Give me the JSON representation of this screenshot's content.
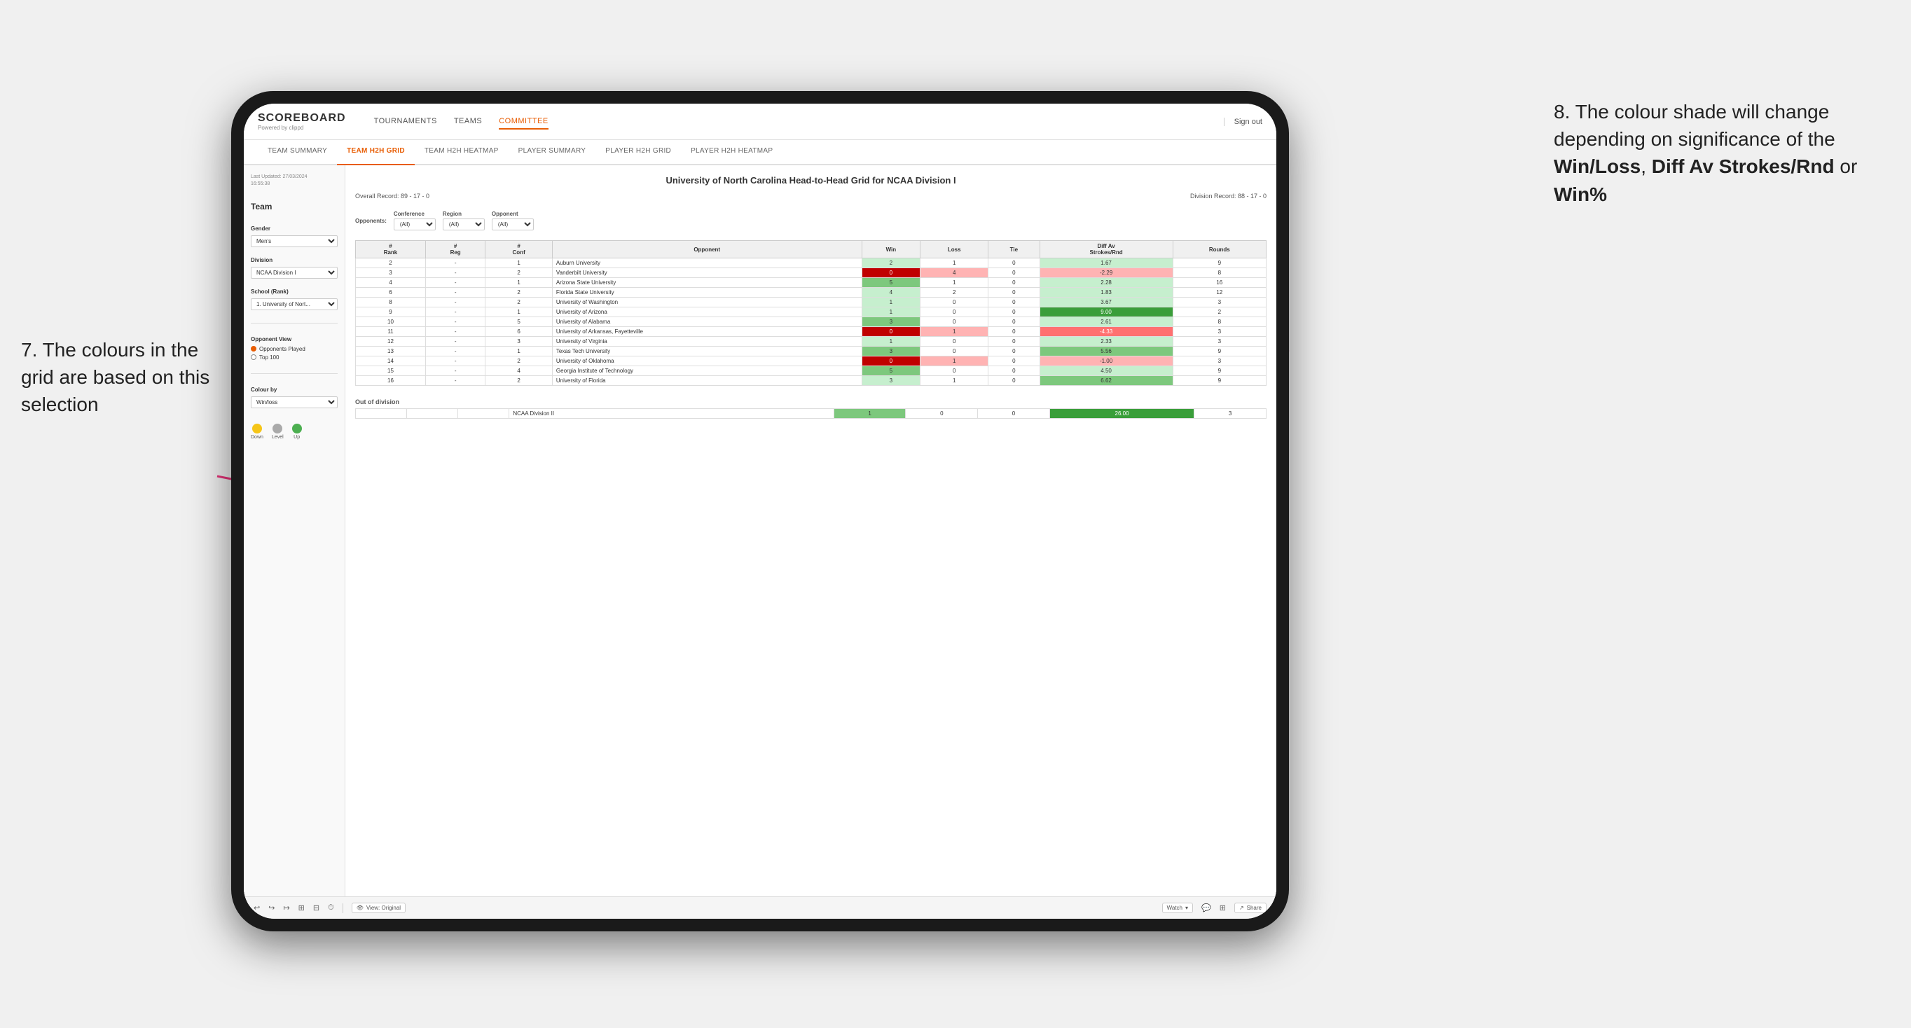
{
  "annotations": {
    "left": "7. The colours in the grid are based on this selection",
    "right_prefix": "8. The colour shade will change depending on significance of the ",
    "right_bold1": "Win/Loss",
    "right_sep1": ", ",
    "right_bold2": "Diff Av Strokes/Rnd",
    "right_sep2": " or ",
    "right_bold3": "Win%"
  },
  "nav": {
    "logo": "SCOREBOARD",
    "logo_sub": "Powered by clippd",
    "links": [
      "TOURNAMENTS",
      "TEAMS",
      "COMMITTEE"
    ],
    "active_link": "COMMITTEE",
    "sign_out": "Sign out"
  },
  "sub_nav": {
    "items": [
      "TEAM SUMMARY",
      "TEAM H2H GRID",
      "TEAM H2H HEATMAP",
      "PLAYER SUMMARY",
      "PLAYER H2H GRID",
      "PLAYER H2H HEATMAP"
    ],
    "active": "TEAM H2H GRID"
  },
  "sidebar": {
    "last_updated_label": "Last Updated: 27/03/2024",
    "last_updated_time": "16:55:38",
    "team_label": "Team",
    "team_value": "",
    "gender_label": "Gender",
    "gender_value": "Men's",
    "division_label": "Division",
    "division_value": "NCAA Division I",
    "school_label": "School (Rank)",
    "school_value": "1. University of Nort...",
    "opponent_view_label": "Opponent View",
    "radio_options": [
      "Opponents Played",
      "Top 100"
    ],
    "radio_selected": "Opponents Played",
    "colour_by_label": "Colour by",
    "colour_by_value": "Win/loss",
    "legend": {
      "down_label": "Down",
      "level_label": "Level",
      "up_label": "Up",
      "down_color": "#f5c518",
      "level_color": "#aaaaaa",
      "up_color": "#4caf50"
    }
  },
  "grid": {
    "title": "University of North Carolina Head-to-Head Grid for NCAA Division I",
    "overall_record": "Overall Record: 89 - 17 - 0",
    "division_record": "Division Record: 88 - 17 - 0",
    "filters": {
      "conference_label": "Conference",
      "conference_value": "(All)",
      "region_label": "Region",
      "region_value": "(All)",
      "opponent_label": "Opponent",
      "opponent_value": "(All)",
      "opponents_label": "Opponents:"
    },
    "table_headers": [
      "#\nRank",
      "#\nReg",
      "#\nConf",
      "Opponent",
      "Win",
      "Loss",
      "Tie",
      "Diff Av\nStrokes/Rnd",
      "Rounds"
    ],
    "rows": [
      {
        "rank": "2",
        "reg": "-",
        "conf": "1",
        "opponent": "Auburn University",
        "win": 2,
        "loss": 1,
        "tie": 0,
        "diff": "1.67",
        "rounds": 9,
        "win_color": "green-light",
        "loss_color": "neutral",
        "diff_color": "green-light"
      },
      {
        "rank": "3",
        "reg": "-",
        "conf": "2",
        "opponent": "Vanderbilt University",
        "win": 0,
        "loss": 4,
        "tie": 0,
        "diff": "-2.29",
        "rounds": 8,
        "win_color": "red-dark",
        "loss_color": "red-light",
        "diff_color": "red-light"
      },
      {
        "rank": "4",
        "reg": "-",
        "conf": "1",
        "opponent": "Arizona State University",
        "win": 5,
        "loss": 1,
        "tie": 0,
        "diff": "2.28",
        "rounds": 16,
        "win_color": "green-mid",
        "loss_color": "neutral",
        "diff_color": "green-light"
      },
      {
        "rank": "6",
        "reg": "-",
        "conf": "2",
        "opponent": "Florida State University",
        "win": 4,
        "loss": 2,
        "tie": 0,
        "diff": "1.83",
        "rounds": 12,
        "win_color": "green-light",
        "loss_color": "neutral",
        "diff_color": "green-light"
      },
      {
        "rank": "8",
        "reg": "-",
        "conf": "2",
        "opponent": "University of Washington",
        "win": 1,
        "loss": 0,
        "tie": 0,
        "diff": "3.67",
        "rounds": 3,
        "win_color": "green-light",
        "loss_color": "neutral",
        "diff_color": "green-light"
      },
      {
        "rank": "9",
        "reg": "-",
        "conf": "1",
        "opponent": "University of Arizona",
        "win": 1,
        "loss": 0,
        "tie": 0,
        "diff": "9.00",
        "rounds": 2,
        "win_color": "green-light",
        "loss_color": "neutral",
        "diff_color": "green-dark"
      },
      {
        "rank": "10",
        "reg": "-",
        "conf": "5",
        "opponent": "University of Alabama",
        "win": 3,
        "loss": 0,
        "tie": 0,
        "diff": "2.61",
        "rounds": 8,
        "win_color": "green-mid",
        "loss_color": "neutral",
        "diff_color": "green-light"
      },
      {
        "rank": "11",
        "reg": "-",
        "conf": "6",
        "opponent": "University of Arkansas, Fayetteville",
        "win": 0,
        "loss": 1,
        "tie": 0,
        "diff": "-4.33",
        "rounds": 3,
        "win_color": "red-dark",
        "loss_color": "red-light",
        "diff_color": "red-mid"
      },
      {
        "rank": "12",
        "reg": "-",
        "conf": "3",
        "opponent": "University of Virginia",
        "win": 1,
        "loss": 0,
        "tie": 0,
        "diff": "2.33",
        "rounds": 3,
        "win_color": "green-light",
        "loss_color": "neutral",
        "diff_color": "green-light"
      },
      {
        "rank": "13",
        "reg": "-",
        "conf": "1",
        "opponent": "Texas Tech University",
        "win": 3,
        "loss": 0,
        "tie": 0,
        "diff": "5.56",
        "rounds": 9,
        "win_color": "green-mid",
        "loss_color": "neutral",
        "diff_color": "green-mid"
      },
      {
        "rank": "14",
        "reg": "-",
        "conf": "2",
        "opponent": "University of Oklahoma",
        "win": 0,
        "loss": 1,
        "tie": 0,
        "diff": "-1.00",
        "rounds": 3,
        "win_color": "red-dark",
        "loss_color": "red-light",
        "diff_color": "red-light"
      },
      {
        "rank": "15",
        "reg": "-",
        "conf": "4",
        "opponent": "Georgia Institute of Technology",
        "win": 5,
        "loss": 0,
        "tie": 0,
        "diff": "4.50",
        "rounds": 9,
        "win_color": "green-mid",
        "loss_color": "neutral",
        "diff_color": "green-light"
      },
      {
        "rank": "16",
        "reg": "-",
        "conf": "2",
        "opponent": "University of Florida",
        "win": 3,
        "loss": 1,
        "tie": 0,
        "diff": "6.62",
        "rounds": 9,
        "win_color": "green-light",
        "loss_color": "neutral",
        "diff_color": "green-mid"
      }
    ],
    "out_of_division_label": "Out of division",
    "out_of_division_rows": [
      {
        "opponent": "NCAA Division II",
        "win": 1,
        "loss": 0,
        "tie": 0,
        "diff": "26.00",
        "rounds": 3,
        "win_color": "green-mid",
        "diff_color": "green-dark"
      }
    ]
  },
  "toolbar": {
    "view_label": "View: Original",
    "watch_label": "Watch",
    "share_label": "Share"
  },
  "colors": {
    "green_dark": "#3a9e3a",
    "green_mid": "#7dc87d",
    "green_light": "#c6efce",
    "yellow": "#ffeb9c",
    "red_light": "#ffb3b3",
    "red_mid": "#ff7070",
    "red_dark": "#c00000",
    "orange": "#ffa500",
    "accent": "#e85d04"
  }
}
